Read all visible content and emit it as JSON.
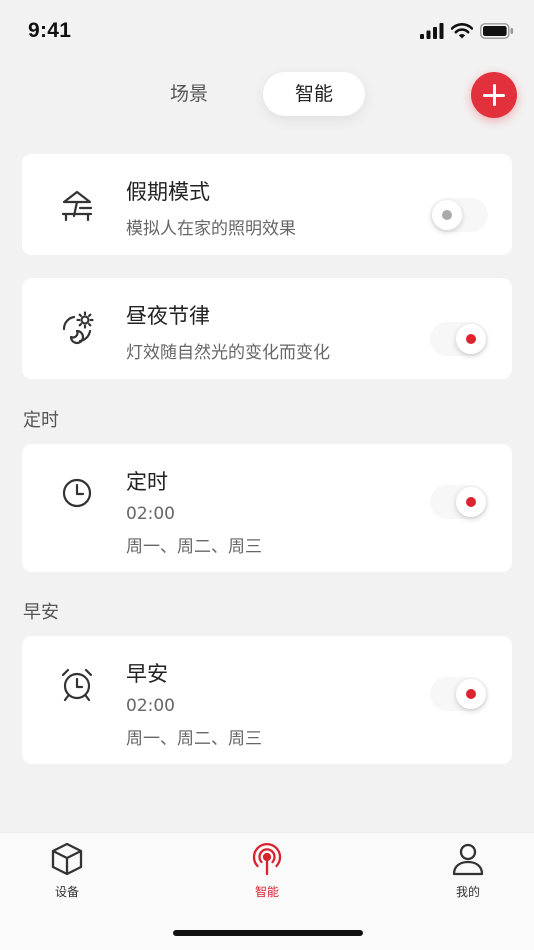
{
  "status_bar": {
    "time": "9:41"
  },
  "header": {
    "tabs": [
      {
        "label": "场景",
        "active": false
      },
      {
        "label": "智能",
        "active": true
      }
    ],
    "add_icon": "plus-icon"
  },
  "automations": [
    {
      "icon": "beach-umbrella-icon",
      "title": "假期模式",
      "subtitle": "模拟人在家的照明效果",
      "enabled": false
    },
    {
      "icon": "day-night-cycle-icon",
      "title": "昼夜节律",
      "subtitle": "灯效随自然光的变化而变化",
      "enabled": true
    }
  ],
  "sections": [
    {
      "label": "定时",
      "card": {
        "icon": "clock-icon",
        "title": "定时",
        "time": "02:00",
        "days": "周一、周二、周三",
        "enabled": true
      }
    },
    {
      "label": "早安",
      "card": {
        "icon": "alarm-clock-icon",
        "title": "早安",
        "time": "02:00",
        "days": "周一、周二、周三",
        "enabled": true
      }
    }
  ],
  "tabbar": {
    "items": [
      {
        "label": "设备",
        "icon": "cube-icon",
        "active": false
      },
      {
        "label": "智能",
        "icon": "broadcast-icon",
        "active": true
      },
      {
        "label": "我的",
        "icon": "person-icon",
        "active": false
      }
    ]
  },
  "colors": {
    "accent": "#e2313d",
    "background": "#f2f2f2",
    "card": "#ffffff"
  }
}
